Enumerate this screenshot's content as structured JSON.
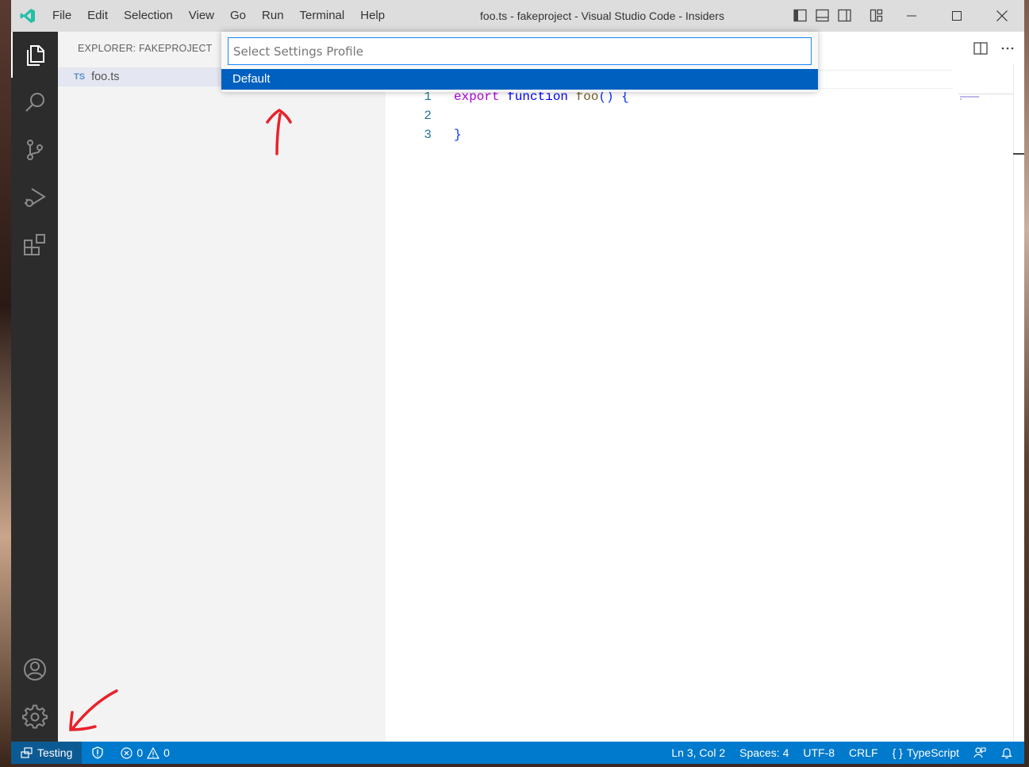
{
  "window": {
    "title": "foo.ts - fakeproject - Visual Studio Code - Insiders"
  },
  "menu": [
    "File",
    "Edit",
    "Selection",
    "View",
    "Go",
    "Run",
    "Terminal",
    "Help"
  ],
  "sidebar": {
    "title": "EXPLORER: FAKEPROJECT",
    "files": [
      {
        "badge": "TS",
        "name": "foo.ts"
      }
    ]
  },
  "quick_pick": {
    "placeholder": "Select Settings Profile",
    "items": [
      "Default"
    ]
  },
  "editor": {
    "lines": [
      {
        "number": "1",
        "export": "export",
        "function": "function",
        "name": "foo",
        "parens": "()",
        "brace": "{"
      },
      {
        "number": "2"
      },
      {
        "number": "3",
        "close": "}"
      }
    ]
  },
  "statusbar": {
    "profile": "Testing",
    "errors": "0",
    "warnings": "0",
    "position": "Ln 3, Col 2",
    "spaces": "Spaces: 4",
    "encoding": "UTF-8",
    "eol": "CRLF",
    "language_icon": "{ }",
    "language": "TypeScript"
  },
  "colors": {
    "statusbar": "#007acc",
    "activitybar": "#2c2c2c",
    "selection": "#0060c0",
    "annotation": "#e8222a"
  }
}
